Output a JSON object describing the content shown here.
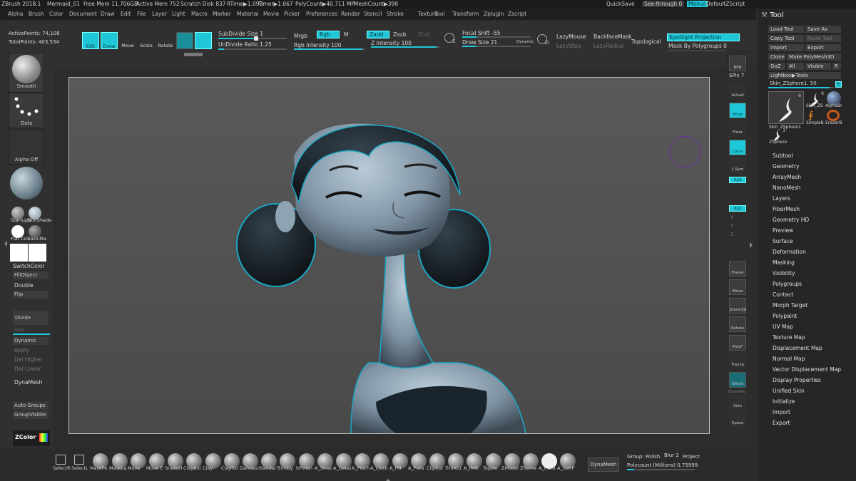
{
  "titlebar": {
    "app": "ZBrush 2018.1",
    "file": "Mermaid_01",
    "free_mem": "Free Mem 11.706GB",
    "active_mem": "Active Mem 752",
    "scratch": "Scratch Disk 837",
    "rtime": "RTime▶1.098",
    "timer": "Timer▶1.067",
    "polycount": "PolyCount▶40.711 MP",
    "meshcount": "MeshCount▶390",
    "quicksave": "QuickSave",
    "see_through": "See-through",
    "see_through_val": "0",
    "menus": "Menus",
    "default_script": "DefaultZScript"
  },
  "menus": [
    "Alpha",
    "Brush",
    "Color",
    "Document",
    "Draw",
    "Edit",
    "File",
    "Layer",
    "Light",
    "Macro",
    "Marker",
    "Material",
    "Movie",
    "Picker",
    "Preferences",
    "Render",
    "Stencil",
    "Stroke",
    "Texture",
    "Tool",
    "Transform",
    "Zplugin",
    "Zscript"
  ],
  "stats": {
    "active_points": "ActivePoints: 74,108",
    "total_points": "TotalPoints: 403,534"
  },
  "toolbar": {
    "edit": "Edit",
    "draw": "Draw",
    "move": "Move",
    "scale": "Scale",
    "rotate": "Rotate",
    "subdivide_size": "SubDivide Size",
    "subdivide_size_val": "1",
    "undivide_ratio": "UnDivide Ratio",
    "undivide_ratio_val": "1.25",
    "mrgb": "Mrgb",
    "rgb": "Rgb",
    "m": "M",
    "rgb_intensity": "Rgb Intensity",
    "rgb_intensity_val": "100",
    "zadd": "Zadd",
    "zsub": "Zsub",
    "zcut": "Zcut",
    "z_intensity": "Z Intensity",
    "z_intensity_val": "100",
    "focal_shift": "Focal Shift",
    "focal_shift_val": "-55",
    "draw_size": "Draw Size",
    "draw_size_val": "21",
    "dynamic": "Dynamic",
    "lazymouse": "LazyMouse",
    "lazystep": "LazyStep",
    "lazyradius": "LazyRadius",
    "backface_mask": "BackfaceMask",
    "topological": "Topological",
    "spotlight_projection": "Spotlight Projection",
    "mask_by_polygroups": "Mask By Polygroups",
    "mask_by_polygroups_val": "0",
    "s_icon": "S",
    "d_icon": "D"
  },
  "leftpanel": {
    "smooth": "Smooth",
    "dots": "Dots",
    "alpha_off": "Alpha Off",
    "startup": "StartupS",
    "skinshade": "SkinShade",
    "flat_color": "Flat Co",
    "basic_mat": "BasicMa",
    "switch_color": "SwitchColor",
    "fill_object": "FillObject",
    "double": "Double",
    "flip": "Flip",
    "divide": "Divide",
    "sdiv": "SDiv",
    "dynamic": "Dynamic",
    "apply": "Apply",
    "del_higher": "Del Higher",
    "del_lower": "Del Lower",
    "dynamesh": "DynaMesh",
    "auto_groups": "Auto Groups",
    "group_visible": "GroupVisible",
    "zcolor": "ZColor"
  },
  "rightshelf": {
    "bpr": "BPR",
    "spix": "SPix",
    "spix_val": "7",
    "actual": "Actual",
    "persp": "Persp",
    "floor": "Floor",
    "local": "Local",
    "lsym": "L.Sym",
    "xyz1": "Xyz",
    "xyz2": "Xyz",
    "x": "X",
    "y": "Y",
    "z": "Z",
    "frame": "Frame",
    "move": "Move",
    "zoom3d": "Zoom3D",
    "rotate": "Rotate",
    "polyf": "PolyF",
    "transp": "Transp",
    "ghost": "Ghost",
    "dynamic": "Dynamic",
    "solo": "Solo",
    "xpose": "Xpose"
  },
  "toolpanel": {
    "title": "Tool",
    "load_tool": "Load Tool",
    "save_as": "Save As",
    "copy_tool": "Copy Tool",
    "paste_tool": "Paste Tool",
    "import": "Import",
    "export": "Export",
    "clone": "Clone",
    "make_polymesh": "Make PolyMesh3D",
    "goz": "GoZ",
    "all": "All",
    "visible": "Visible",
    "r": "R",
    "lightbox_tools": "Lightbox▶Tools",
    "skin_label": "Skin_ZSphere1.",
    "skin_val": "50",
    "r2": "R",
    "thumb_count": "6",
    "thumb_count2": "6",
    "thumb_count3": "3",
    "thumb1": "Skin_ZSphere1",
    "thumb2": "Skin_ZS",
    "thumb3": "AlphaBr",
    "thumb4": "SimpleB",
    "thumb5": "EraserB",
    "thumb6": "ZSphere",
    "sections": [
      "Subtool",
      "Geometry",
      "ArrayMesh",
      "NanoMesh",
      "Layers",
      "FiberMesh",
      "Geometry HD",
      "Preview",
      "Surface",
      "Deformation",
      "Masking",
      "Visibility",
      "Polygroups",
      "Contact",
      "Morph Target",
      "Polypaint",
      "UV Map",
      "Texture Map",
      "Displacement Map",
      "Normal Map",
      "Vector Displacement Map",
      "Display Properties",
      "Unified Skin",
      "Initialize",
      "Import",
      "Export"
    ]
  },
  "brushes": [
    "SelectR",
    "SelectL",
    "MaskPe",
    "MaskLa",
    "Move",
    "Move E",
    "SnakeH",
    "ClayBui",
    "Clay",
    "ClayTut",
    "Damsta",
    "Standar",
    "TrimDy",
    "hPolish",
    "A_Smal",
    "A_Detai",
    "A_Pinch",
    "A_Cloth",
    "A_Fill",
    "A_Polis",
    "ClipCur",
    "TrimCu",
    "A_IMM",
    "Topolo",
    "ZModel",
    "ZReme",
    "A_Hard",
    "A_SoftP"
  ],
  "bottom": {
    "dynamesh": "DynaMesh",
    "group": "Group:",
    "polish": "Polish",
    "blur": "Blur",
    "blur_val": "2",
    "project": "Project",
    "polycount": "Polycount (Millions)",
    "polycount_val": "0.75999"
  },
  "colors": {
    "accent": "#1ec8d8",
    "viewport_bg": "#555555",
    "panel_bg": "#303030"
  }
}
